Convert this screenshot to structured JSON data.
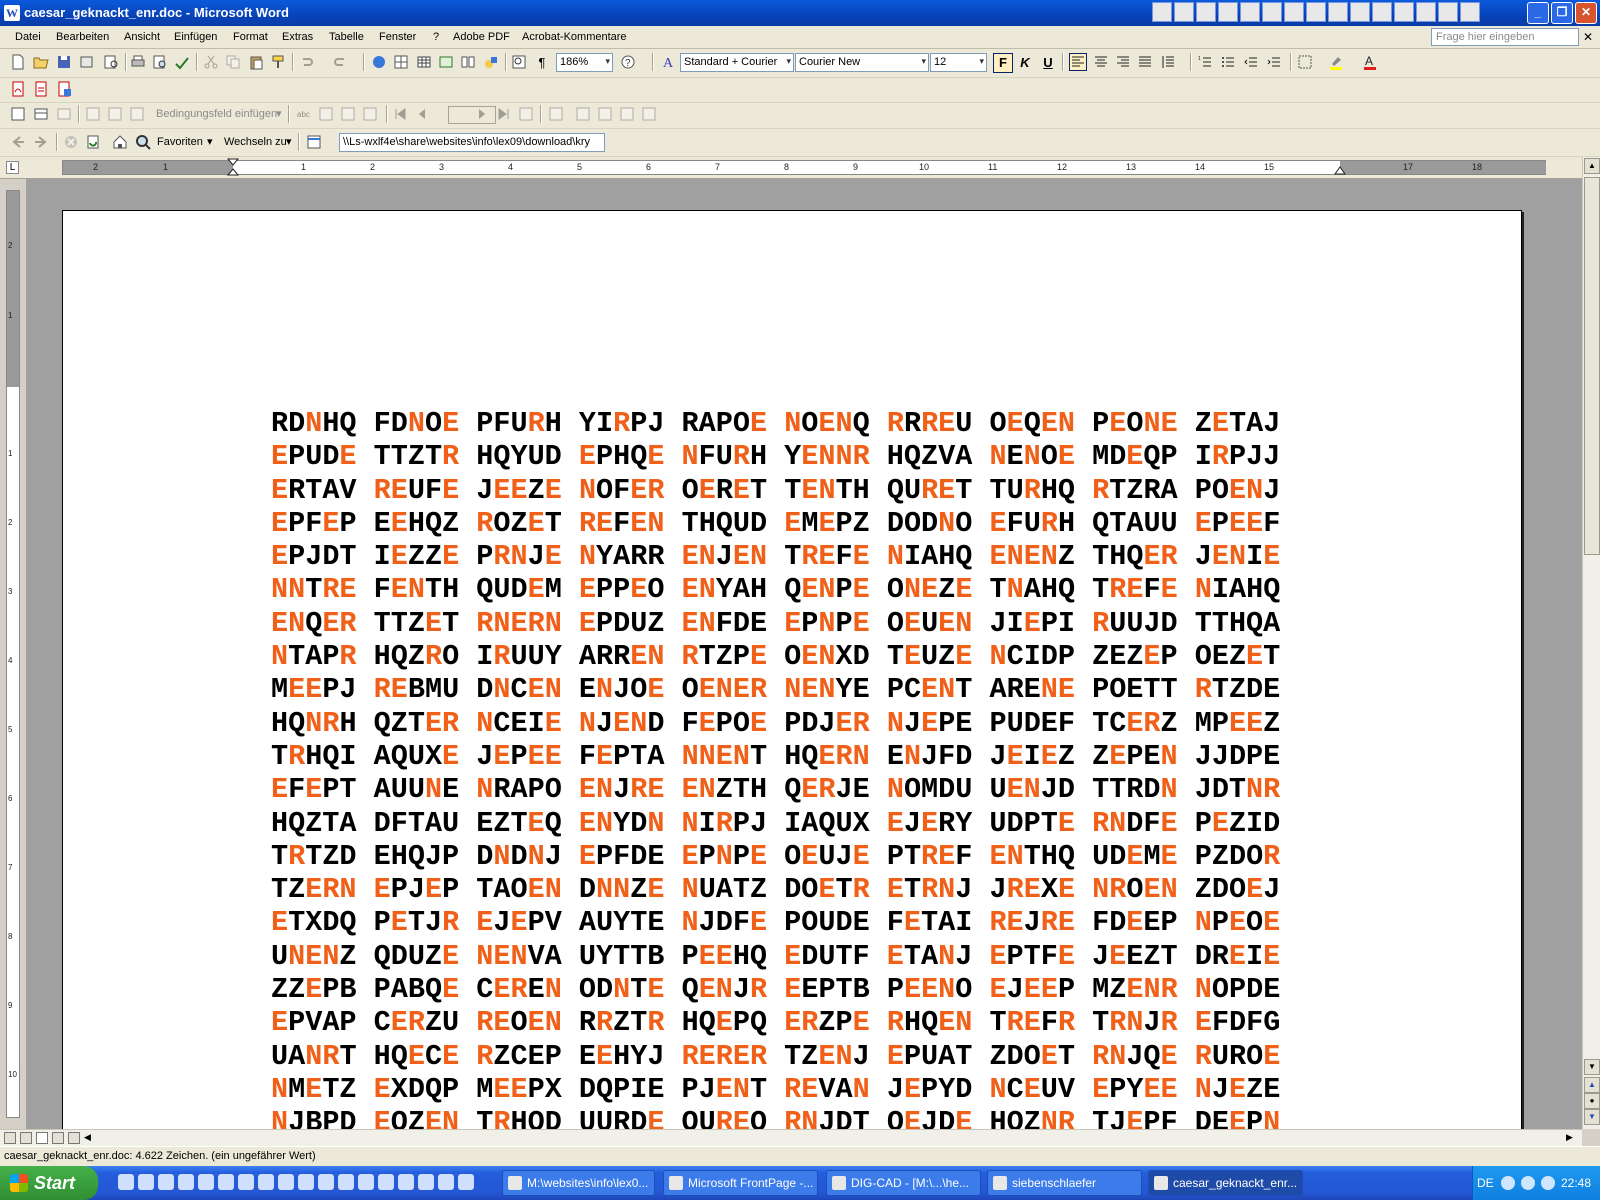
{
  "window": {
    "title": "caesar_geknackt_enr.doc - Microsoft Word"
  },
  "menu": [
    "Datei",
    "Bearbeiten",
    "Ansicht",
    "Einfügen",
    "Format",
    "Extras",
    "Tabelle",
    "Fenster",
    "?",
    "Adobe PDF",
    "Acrobat-Kommentare"
  ],
  "help_placeholder": "Frage hier eingeben",
  "toolbar": {
    "zoom": "186%",
    "style": "Standard + Courier",
    "font": "Courier New",
    "size": "12",
    "bold": "F",
    "italic": "K",
    "underline": "U"
  },
  "mailmerge": {
    "insert_field": "Bedingungsfeld einfügen"
  },
  "web": {
    "favorites": "Favoriten",
    "goto": "Wechseln zu",
    "address": "\\\\Ls-wxlf4e\\share\\websites\\info\\lex09\\download\\kry"
  },
  "ruler_ticks": [
    "2",
    "1",
    "1",
    "2",
    "3",
    "4",
    "5",
    "6",
    "7",
    "8",
    "9",
    "10",
    "11",
    "12",
    "13",
    "14",
    "15",
    "17",
    "18"
  ],
  "vruler_ticks": [
    "2",
    "1",
    "1",
    "2",
    "3",
    "4",
    "5",
    "6",
    "7",
    "8",
    "9",
    "10"
  ],
  "document": {
    "highlight_color": "#f06018",
    "lines": [
      "RD[N]HQ FD[N]O[E] PFU[R]H YI[R]PJ RAPO[E] [N]O[EN]Q [R]R[RE]U O[E]Q[EN] P[E]O[NE] Z[E]TAJ",
      "[E]PUD[E] TTZT[R] HQYUD [E]PHQ[E] [N]FU[R]H Y[ENNR] HQZVA [N]E[N]O[E] MD[E]QP I[R]PJJ",
      "[E]RTAV [RE]UF[E] J[EE]Z[E] [N]OF[ER] O[E]R[E]T T[EN]TH QU[RE]T TU[R]HQ [R]TZRA PO[EN]J",
      "[E]PF[E]P E[E]HQZ [R]OZ[E]T [RE]F[EN] THQUD [E]M[E]PZ DOD[N]O [E]FU[R]H QTAUU [E]P[EE]F",
      "[E]PJDT I[E]ZZ[E] P[RN]J[E] [N]YARR [EN]J[EN] T[RE]F[E] [N]IAHQ [ENEN]Z THQ[ER] J[EN]I[E]",
      "[NN]T[RE] F[EN]TH QUD[E]M [E]PP[E]O [EN]YAH Q[EN]P[E] O[NE]Z[E] T[N]AHQ T[RE]F[E] [N]IAHQ",
      "[EN]Q[ER] TTZ[E]T [RNERN] [E]PDUZ [EN]FDE [E]P[N]P[E] O[E]U[EN] JI[E]PI [R]UUJD TTHQA",
      "[N]TAP[R] HQZ[R]O I[R]UUY ARR[EN] [R]TZP[E] O[EN]XD T[E]UZ[E] [N]CIDP ZEZ[E]P OEZ[E]T",
      "M[EE]PJ [RE]BMU D[N]C[EN] E[N]JO[E] O[ENER] [NEN]YE PC[EN]T ARE[NE] POETT [R]TZDE",
      "HQ[NR]H QZT[ER] [N]CEI[E] [N]J[EN]D F[E]PO[E] PDJ[ER] [N]J[E]PE PUDEF TC[ER]Z MP[EE]Z",
      "T[R]HQI AQUX[E] J[E]P[EE] F[E]PTA [NNEN]T HQ[ERN] E[N]JFD J[E]I[E]Z Z[E]PE[N] JJDPE",
      "[E]F[E]PT AUU[N]E [N]RAPO [EN]J[RE] [EN]ZTH Q[ER]JE [N]OMDU U[EN]JD TTRD[N] JDT[NR]",
      "HQZTA DFTAU EZT[E]Q [EN]YD[N] [N]I[R]PJ IAQUX [E]J[E]RY UDPT[E] [RN]DF[E] P[E]ZID",
      "T[R]TZD EHQJP D[N]D[N]J [E]PFDE [E]P[N]P[E] O[E]UJ[E] PT[RE]F [EN]THQ UD[E]M[E] PZDO[R]",
      "TZ[ERN] [E]PJ[E]P TAO[EN] D[NN]Z[E] [N]UATZ DO[E]T[R] [E]T[RN]J J[RE]X[E] [NR]O[EN] ZDO[E]J",
      "[E]TXDQ P[E]TJ[R] [E]J[E]PV AUYTE [N]JDF[E] POUDE F[E]TAI [RE]J[RE] FD[E]EP [N]P[E]O[E]",
      "U[NEN]Z QDUZ[E] [NEN]VA UYTTB P[EE]HQ [E]DUTF [E]TA[N]J [E]PTF[E] J[E]EZT DR[E]I[E]",
      "ZZ[E]PB PABQ[E] C[ER]E[N] OD[N]T[E] Q[EN]J[R] [E]EPTB P[EEN]O [E]J[EE]P MZ[ENR] [N]OPDE",
      "[E]PVAP C[ER]ZU [RE]O[EN] R[R]ZT[R] HQ[E]PQ [ER]ZP[E] [R]HQ[EN] T[RE]F[R] T[RN]J[R] [E]FDFG",
      "UA[NR]T HQ[E]C[E] [R]ZCEP E[E]HYJ [RERER] TZ[EN]J [E]PUAT ZDO[E]T [RN]JQ[E] [R]UR]O[E]",
      "[N]M[E]TZ [E]XDQP M[EE]PX DQPIE PJ[EN]T [RE]VA[N] J[E]PYD [N]C[E]UV [E]PY[EE] [N]J[E]ZE",
      "[N]JBPD [E]OZ[EN] T[R]HQD UURD[E] QU[RE]Q [RN]JDT O[E]JD[E] HQZ[NR] TJ[E]PF DE[E]P[N]"
    ]
  },
  "status": {
    "text": "caesar_geknackt_enr.doc: 4.622 Zeichen. (ein ungefährer Wert)"
  },
  "taskbar": {
    "start": "Start",
    "tasks": [
      "M:\\websites\\info\\lex0...",
      "Microsoft FrontPage -...",
      "DIG-CAD - [M:\\...\\he...",
      "siebenschlaefer",
      "caesar_geknackt_enr..."
    ],
    "lang": "DE",
    "clock": "22:48"
  }
}
